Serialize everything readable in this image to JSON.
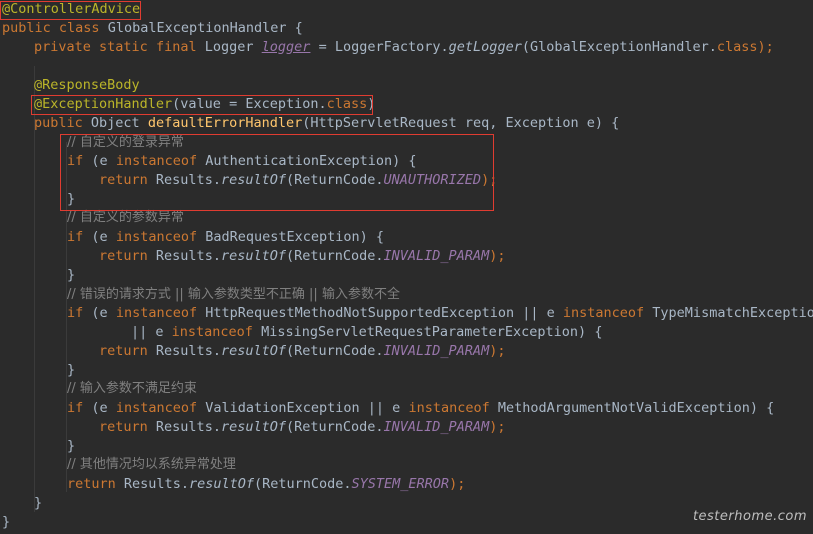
{
  "code": {
    "l1_annotation": "@ControllerAdvice",
    "l2_public": "public",
    "l2_class": "class",
    "l2_name": "GlobalExceptionHandler",
    "l2_brace": "{",
    "l3_private": "private",
    "l3_static": "static",
    "l3_final": "final",
    "l3_type": "Logger",
    "l3_field": "logger",
    "l3_eq": "=",
    "l3_factory": "LoggerFactory.",
    "l3_method": "getLogger",
    "l3_arg_open": "(GlobalExceptionHandler.",
    "l3_class_kw": "class",
    "l3_end": ");",
    "l4_annotation": "@ResponseBody",
    "l5_annotation": "@ExceptionHandler",
    "l5_args_open": "(value = Exception.",
    "l5_class_kw": "class",
    "l5_close": ")",
    "l6_public": "public",
    "l6_type": "Object",
    "l6_method": "defaultErrorHandler",
    "l6_params": "(HttpServletRequest req, Exception e) {",
    "l7_comment": "// 自定义的登录异常",
    "l8_if": "if",
    "l8_open": "(e",
    "l8_instanceof": "instanceof",
    "l8_rest": "AuthenticationException) {",
    "l9_return": "return",
    "l9_results": "Results.",
    "l9_method": "resultOf",
    "l9_open": "(ReturnCode.",
    "l9_const": "UNAUTHORIZED",
    "l9_end": ");",
    "l10_brace": "}",
    "l11_comment": "// 自定义的参数异常",
    "l12_if": "if",
    "l12_open": "(e",
    "l12_instanceof": "instanceof",
    "l12_rest": "BadRequestException) {",
    "l13_return": "return",
    "l13_results": "Results.",
    "l13_method": "resultOf",
    "l13_open": "(ReturnCode.",
    "l13_const": "INVALID_PARAM",
    "l13_end": ");",
    "l14_brace": "}",
    "l15_comment": "// 错误的请求方式 || 输入参数类型不正确 || 输入参数不全",
    "l16_if": "if",
    "l16_open": "(e",
    "l16_instanceof": "instanceof",
    "l16_type": "HttpRequestMethodNotSupportedException || e",
    "l16_instanceof2": "instanceof",
    "l16_rest": "TypeMismatchException",
    "l17_or": "|| e",
    "l17_instanceof": "instanceof",
    "l17_rest": "MissingServletRequestParameterException) {",
    "l18_return": "return",
    "l18_results": "Results.",
    "l18_method": "resultOf",
    "l18_open": "(ReturnCode.",
    "l18_const": "INVALID_PARAM",
    "l18_end": ");",
    "l19_brace": "}",
    "l20_comment": "// 输入参数不满足约束",
    "l21_if": "if",
    "l21_open": "(e",
    "l21_instanceof": "instanceof",
    "l21_type": "ValidationException || e",
    "l21_instanceof2": "instanceof",
    "l21_rest": "MethodArgumentNotValidException) {",
    "l22_return": "return",
    "l22_results": "Results.",
    "l22_method": "resultOf",
    "l22_open": "(ReturnCode.",
    "l22_const": "INVALID_PARAM",
    "l22_end": ");",
    "l23_brace": "}",
    "l24_comment": "// 其他情况均以系统异常处理",
    "l25_return": "return",
    "l25_results": "Results.",
    "l25_method": "resultOf",
    "l25_open": "(ReturnCode.",
    "l25_const": "SYSTEM_ERROR",
    "l25_end": ");",
    "l26_brace": "}",
    "l27_brace": "}"
  },
  "watermark": "testerhome.com",
  "colors": {
    "background": "#2b2b2b",
    "keyword": "#cc7832",
    "annotation": "#bbb529",
    "comment": "#808080",
    "constant": "#9876aa",
    "method": "#ffc66d",
    "text": "#a9b7c6",
    "highlight_box": "#e03c31"
  }
}
